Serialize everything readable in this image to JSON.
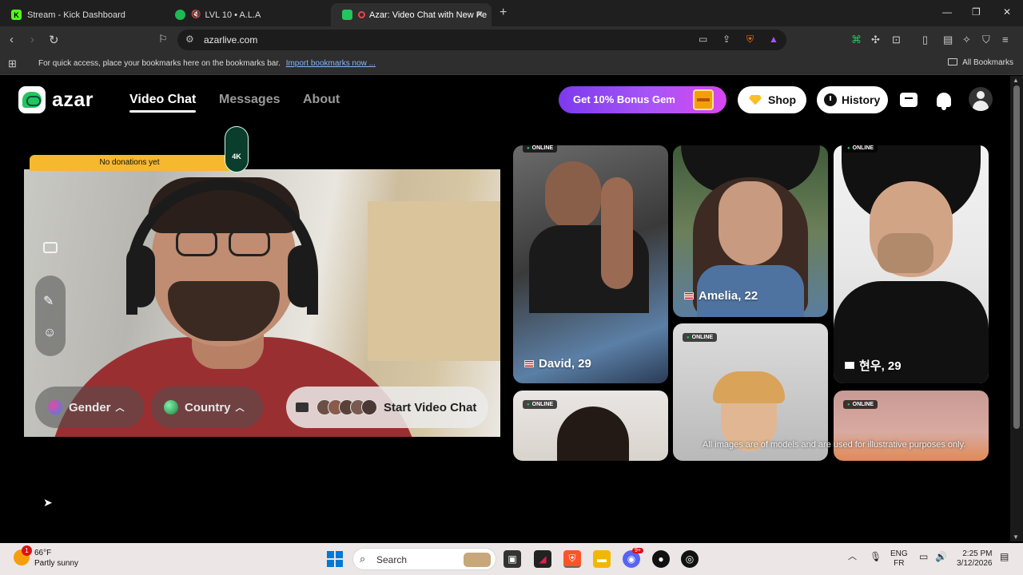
{
  "browser": {
    "tabs": [
      {
        "title": "Stream - Kick Dashboard",
        "icon": "kick-icon",
        "color": "#53fc18",
        "letter": "K"
      },
      {
        "title": "LVL 10 • A.L.A",
        "icon": "spotify-icon",
        "color": "#1db954",
        "letter": "♪"
      },
      {
        "title": "Azar: Video Chat with New Pe",
        "icon": "azar-icon",
        "color": "#22c55e",
        "letter": "a"
      }
    ],
    "new_tab": "+",
    "url": "azarlive.com",
    "bookmarks_message": "For quick access, place your bookmarks here on the bookmarks bar.",
    "import_bookmarks": "Import bookmarks now ...",
    "all_bookmarks": "All Bookmarks",
    "window_controls": [
      "—",
      "❐",
      "✕"
    ]
  },
  "app": {
    "logo": "azar",
    "nav": [
      {
        "label": "Video Chat",
        "active": true
      },
      {
        "label": "Messages",
        "active": false
      },
      {
        "label": "About",
        "active": false
      }
    ],
    "promo": "Get 10% Bonus Gem",
    "shop": "Shop",
    "history": "History",
    "accent": "#22c55e",
    "promo_gradient": [
      "#7c3aed",
      "#d946ef"
    ]
  },
  "video": {
    "donation_text": "No donations yet",
    "badge": "4K",
    "gender_label": "Gender",
    "country_label": "Country",
    "start_label": "Start Video Chat"
  },
  "profiles": [
    {
      "name": "David, 29",
      "online": true,
      "online_label": "ONLINE"
    },
    {
      "name": "Amelia, 22",
      "online": false,
      "online_label": ""
    },
    {
      "name": "현우, 29",
      "online": true,
      "online_label": "ONLINE"
    },
    {
      "name": "",
      "online": true,
      "online_label": "ONLINE"
    },
    {
      "name": "",
      "online": true,
      "online_label": "ONLINE"
    },
    {
      "name": "",
      "online": true,
      "online_label": "ONLINE"
    }
  ],
  "disclaimer": "All images are of models and are used for illustrative purposes only.",
  "taskbar": {
    "weather_temp": "66°F",
    "weather_desc": "Partly sunny",
    "weather_badge": "1",
    "search_placeholder": "Search",
    "lang_top": "ENG",
    "lang_bottom": "FR",
    "time": "2:25 PM",
    "date": "3/12/2026",
    "discord_badge": "9+"
  }
}
